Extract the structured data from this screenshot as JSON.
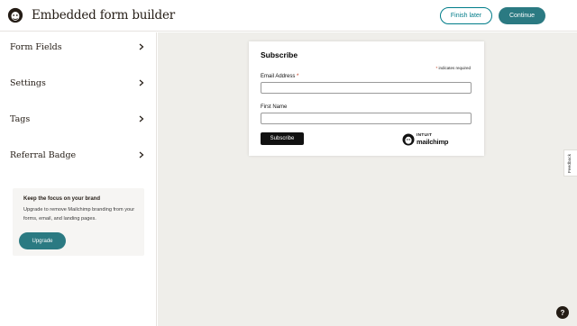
{
  "header": {
    "title": "Embedded form builder",
    "finish_later": "Finish later",
    "continue": "Continue"
  },
  "sidebar": {
    "items": [
      {
        "label": "Form Fields"
      },
      {
        "label": "Settings"
      },
      {
        "label": "Tags"
      },
      {
        "label": "Referral Badge"
      }
    ],
    "upgrade": {
      "title": "Keep the focus on your brand",
      "text": "Upgrade to remove Mailchimp branding from your forms, email, and landing pages.",
      "button": "Upgrade"
    }
  },
  "form": {
    "title": "Subscribe",
    "required_star": "*",
    "required_note": "indicates required",
    "fields": [
      {
        "label": "Email Address",
        "required": "*",
        "value": ""
      },
      {
        "label": "First Name",
        "value": ""
      }
    ],
    "submit": "Subscribe",
    "brand_intuit": "INTUIT",
    "brand_mailchimp": "mailchimp"
  },
  "feedback": "Feedback",
  "help": "?",
  "colors": {
    "accent": "#2b7a82",
    "required": "#c02b0a",
    "canvas": "#efeeea"
  }
}
